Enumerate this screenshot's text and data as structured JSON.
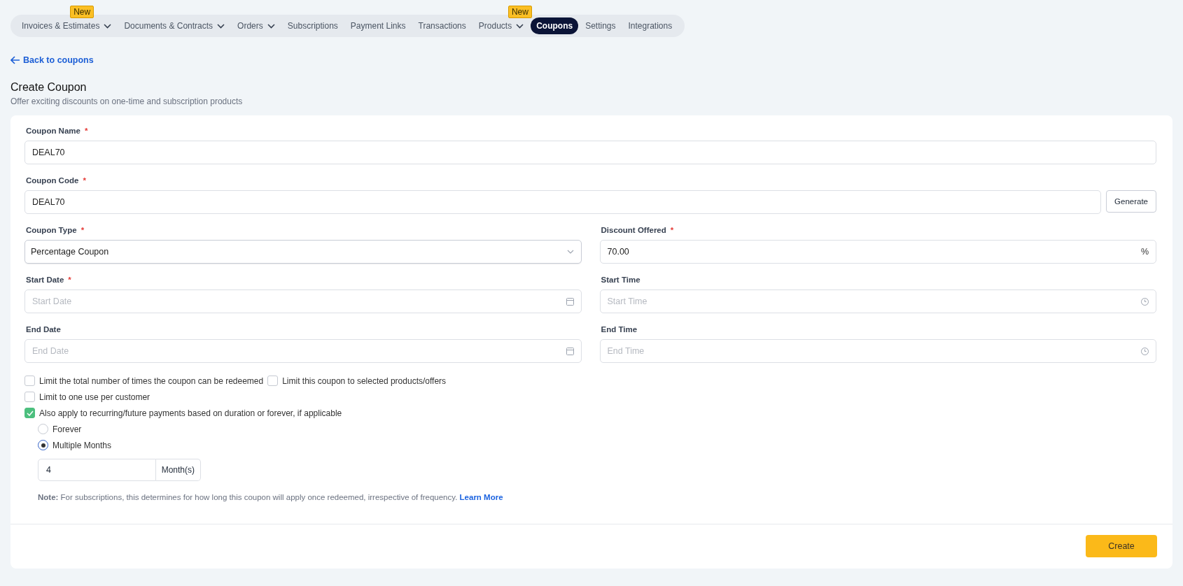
{
  "nav": [
    {
      "label": "Invoices & Estimates",
      "dropdown": true,
      "badge": "New",
      "selected": false
    },
    {
      "label": "Documents & Contracts",
      "dropdown": true,
      "selected": false
    },
    {
      "label": "Orders",
      "dropdown": true,
      "selected": false
    },
    {
      "label": "Subscriptions",
      "dropdown": false,
      "selected": false
    },
    {
      "label": "Payment Links",
      "dropdown": false,
      "selected": false
    },
    {
      "label": "Transactions",
      "dropdown": false,
      "selected": false
    },
    {
      "label": "Products",
      "dropdown": true,
      "badge": "New",
      "selected": false
    },
    {
      "label": "Coupons",
      "dropdown": false,
      "selected": true
    },
    {
      "label": "Settings",
      "dropdown": false,
      "selected": false
    },
    {
      "label": "Integrations",
      "dropdown": false,
      "selected": false
    }
  ],
  "back_link": "Back to coupons",
  "title": "Create Coupon",
  "subtitle": "Offer exciting discounts on one-time and subscription products",
  "field_rows": [
    [
      {
        "kind": "text",
        "label": "Coupon Name",
        "required_mark": "*",
        "value": "DEAL70"
      }
    ],
    [
      {
        "kind": "text",
        "label": "Coupon Code",
        "required_mark": "*",
        "value": "DEAL70",
        "button": "Generate"
      }
    ],
    [
      {
        "kind": "select",
        "label": "Coupon Type",
        "required_mark": "*",
        "value": "Percentage Coupon"
      },
      {
        "kind": "text",
        "label": "Discount Offered",
        "required_mark": "*",
        "value": "70.00",
        "suffix": "%"
      }
    ],
    [
      {
        "kind": "date",
        "label": "Start Date",
        "required_mark": "*",
        "placeholder": "Start Date"
      },
      {
        "kind": "time",
        "label": "Start Time",
        "placeholder": "Start Time"
      }
    ],
    [
      {
        "kind": "date",
        "label": "End Date",
        "placeholder": "End Date"
      },
      {
        "kind": "time",
        "label": "End Time",
        "placeholder": "End Time"
      }
    ]
  ],
  "checkbox_rows": [
    [
      {
        "label": "Limit the total number of times the coupon can be redeemed",
        "checked": false
      },
      {
        "label": "Limit this coupon to selected products/offers",
        "checked": false
      }
    ],
    [
      {
        "label": "Limit to one use per customer",
        "checked": false
      }
    ],
    [
      {
        "label": "Also apply to recurring/future payments based on duration or forever, if applicable",
        "checked": true
      }
    ]
  ],
  "radios": [
    {
      "label": "Forever",
      "selected": false
    },
    {
      "label": "Multiple Months",
      "selected": true
    }
  ],
  "duration": {
    "value": "4",
    "unit": "Month(s)"
  },
  "note": "**Note:** For subscriptions, this determines for how long this coupon will apply once redeemed, irrespective of frequency.",
  "note_link": "Learn More",
  "create_button": "Create"
}
